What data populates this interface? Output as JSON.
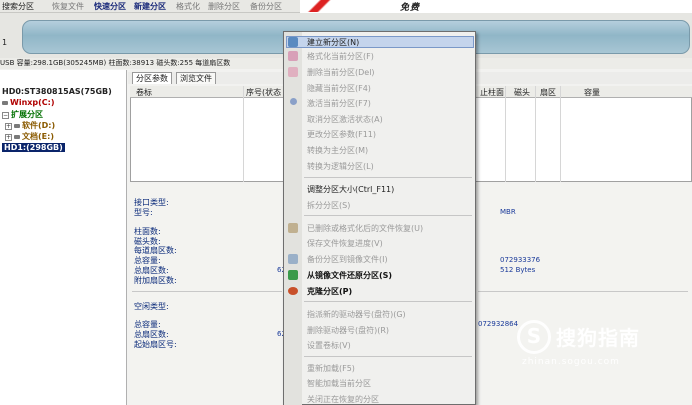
{
  "toolbar": {
    "items": [
      "搜索分区",
      "恢复文件",
      "快速分区",
      "新建分区",
      "格式化",
      "删除分区",
      "备份分区"
    ]
  },
  "banner": {
    "text": "免费"
  },
  "disk_bar": {
    "disk_number": "1",
    "info": "USB  容量:298.1GB(305245MB)  柱面数:38913  磁头数:255  每道扇区数"
  },
  "tree": {
    "hd0": "HD0:ST380815AS(75GB)",
    "winxp": "Winxp(C:)",
    "extended": "扩展分区",
    "software": "软件(D:)",
    "documents": "文档(E:)",
    "hd1": "HD1:(298GB)"
  },
  "tabs": [
    "分区参数",
    "浏览文件"
  ],
  "grid": {
    "columns": [
      "卷标",
      "序号(状态",
      "止柱面",
      "磁头",
      "扇区",
      "容量"
    ]
  },
  "details": {
    "interface_type": "接口类型:",
    "model": "型号:",
    "mbr": "MBR",
    "cylinders": "柱面数:",
    "heads": "磁头数:",
    "sectors_per_track": "每道扇区数:",
    "total_capacity": "总容量:",
    "total_sectors": "总扇区数:",
    "extra_sectors": "附加扇区数:",
    "total_bytes_value": "072933376",
    "bytes_value": "512 Bytes",
    "left_value_1": "62",
    "left_value_2": "62",
    "free_type": "空闲类型:",
    "total_capacity2": "总容量:",
    "total_sectors2": "总扇区数:",
    "start_sector": "起始扇区号:",
    "sector_value2": "072932864"
  },
  "context_menu": {
    "items": [
      {
        "label": "建立新分区(N)",
        "state": "highlight"
      },
      {
        "label": "格式化当前分区(F)",
        "state": "disabled"
      },
      {
        "label": "删除当前分区(Del)",
        "state": "disabled"
      },
      {
        "label": "隐藏当前分区(F4)",
        "state": "disabled"
      },
      {
        "label": "激活当前分区(F7)",
        "state": "disabled"
      },
      {
        "label": "取消分区激活状态(A)",
        "state": "disabled"
      },
      {
        "label": "更改分区参数(F11)",
        "state": "disabled"
      },
      {
        "label": "转换为主分区(M)",
        "state": "disabled"
      },
      {
        "label": "转换为逻辑分区(L)",
        "state": "disabled"
      },
      {
        "label": "调整分区大小(Ctrl_F11)",
        "state": "normal"
      },
      {
        "label": "拆分分区(S)",
        "state": "disabled"
      },
      {
        "label": "已删除或格式化后的文件恢复(U)",
        "state": "disabled"
      },
      {
        "label": "保存文件恢复进度(V)",
        "state": "disabled"
      },
      {
        "label": "备份分区到镜像文件(I)",
        "state": "disabled"
      },
      {
        "label": "从镜像文件还原分区(S)",
        "state": "bold"
      },
      {
        "label": "克隆分区(P)",
        "state": "bold"
      },
      {
        "label": "指派新的驱动器号(盘符)(G)",
        "state": "disabled"
      },
      {
        "label": "删除驱动器号(盘符)(R)",
        "state": "disabled"
      },
      {
        "label": "设置卷标(V)",
        "state": "disabled"
      },
      {
        "label": "重新加载(F5)",
        "state": "disabled"
      },
      {
        "label": "智能加载当前分区",
        "state": "disabled"
      },
      {
        "label": "关闭正在恢复的分区",
        "state": "disabled"
      }
    ]
  },
  "watermark": {
    "logo": "S",
    "text": "搜狗指南",
    "url": "zhinan.sogou.com"
  },
  "colors": {
    "accent": "#0a246a",
    "menu_highlight": "#c4d4ec",
    "disk_bar": "#9fc0cf",
    "label_blue": "#0a2a7a"
  }
}
